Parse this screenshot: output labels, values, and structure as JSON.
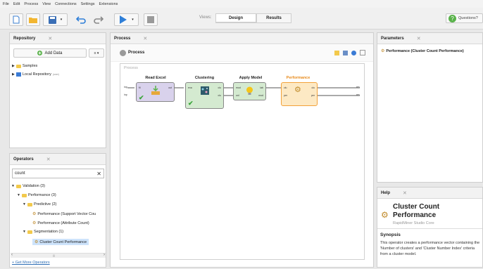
{
  "menu": [
    "File",
    "Edit",
    "Process",
    "View",
    "Connections",
    "Settings",
    "Extensions"
  ],
  "toolbar": {
    "views_label": "Views:",
    "tabs": [
      "Design",
      "Results"
    ],
    "questions_label": "Questions?"
  },
  "repository": {
    "title": "Repository",
    "add_data_label": "Add Data",
    "menu_label": "≡ ▾",
    "items": [
      {
        "label": "Samples"
      },
      {
        "label": "Local Repository",
        "tag": "(user)"
      }
    ]
  },
  "operators": {
    "title": "Operators",
    "search_value": "count",
    "tree": [
      "Validation (3)",
      "Performance (3)",
      "Predictive (2)",
      "Performance (Support Vector Cou",
      "Performance (Attribute Count)",
      "Segmentation (1)",
      "Cluster Count Performance"
    ],
    "get_more_label": "+ Get More Operators"
  },
  "process": {
    "tab_title": "Process",
    "header_title": "Process",
    "canvas_label": "Process",
    "operators": [
      {
        "title": "Read Excel",
        "ports_in": [
          "fil"
        ],
        "ports_out": [
          "out"
        ]
      },
      {
        "title": "Clustering",
        "ports_in": [
          "exa"
        ],
        "ports_out": [
          "clu",
          "clu"
        ]
      },
      {
        "title": "Apply Model",
        "ports_in": [
          "mod",
          "unl"
        ],
        "ports_out": [
          "lab",
          "mod"
        ]
      },
      {
        "title": "Performance",
        "ports_in": [
          "clu",
          "per"
        ],
        "ports_out": [
          "clu",
          "per"
        ]
      }
    ],
    "left_ports": [
      "inp",
      "inp"
    ],
    "right_ports": [
      "res",
      "res"
    ]
  },
  "parameters": {
    "title": "Parameters",
    "operator_label": "Performance (Cluster Count Performance)"
  },
  "help": {
    "title": "Help",
    "operator_name": "Cluster Count Performance",
    "subtitle": "RapidMiner Studio Core",
    "synopsis_heading": "Synopsis",
    "synopsis_text": "This operator creates a performance vector containing the 'Number of clusters' and 'Cluster Number Index' criteria from a cluster model."
  },
  "colors": {
    "read_excel": "#d9d2ec",
    "clustering": "#d4ead0",
    "apply_model": "#d4ead0",
    "performance_fill": "#fde9c4",
    "performance_border": "#f2a13a",
    "accent_blue": "#2f7fd8",
    "selected_row": "#cde3fb"
  }
}
